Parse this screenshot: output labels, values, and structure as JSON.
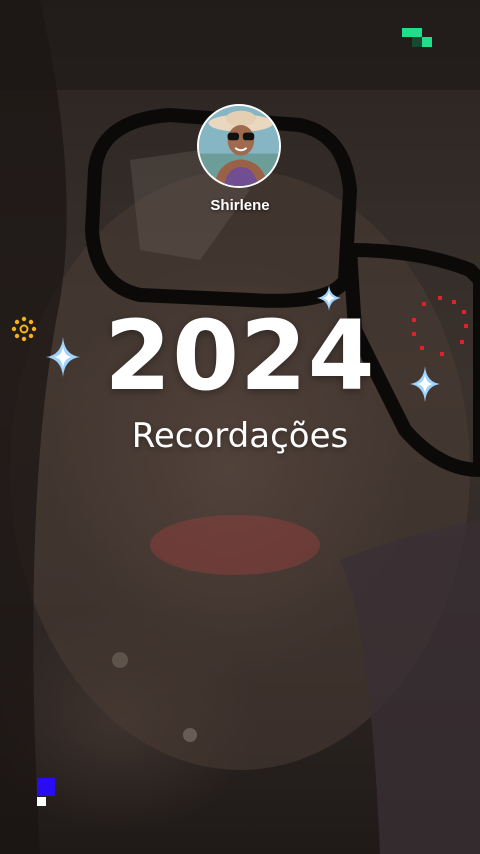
{
  "profile": {
    "name": "Shirlene",
    "avatar_icon": "profile-photo"
  },
  "story": {
    "year": "2024",
    "title": "Recordações"
  },
  "colors": {
    "text": "#ffffff",
    "sparkle_blue": "#9fd4ff",
    "accent_green": "#1ee08a",
    "accent_blue": "#2a0cf0",
    "accent_yellow": "#f5b21a",
    "accent_red": "#e0202a"
  },
  "decorations": [
    "pixel-cluster-icon",
    "sparkle-icon",
    "sunburst-icon",
    "red-dot-ring-icon",
    "blue-square-icon"
  ]
}
